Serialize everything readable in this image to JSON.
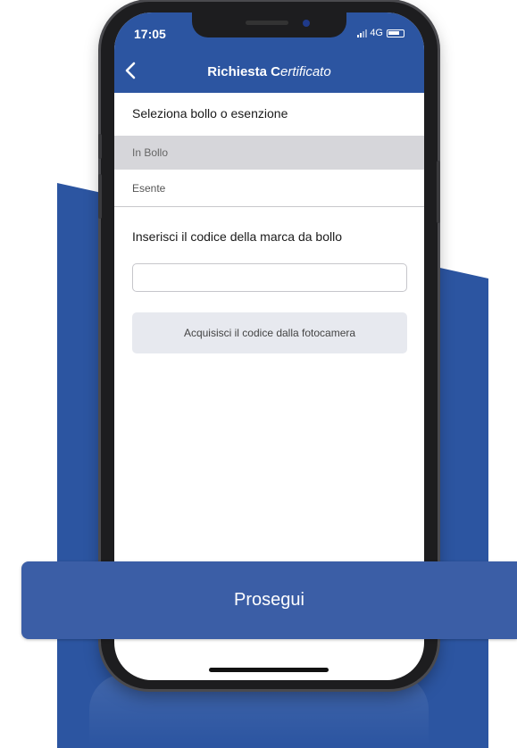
{
  "status_bar": {
    "time": "17:05",
    "network": "4G"
  },
  "header": {
    "title_plain": "Richiesta C",
    "title_italic": "ertificato"
  },
  "stamp_section": {
    "label": "Seleziona bollo o esenzione",
    "options": [
      {
        "label": "In Bollo",
        "selected": true
      },
      {
        "label": "Esente",
        "selected": false
      }
    ]
  },
  "code_section": {
    "label": "Inserisci il codice della marca da bollo",
    "input_value": "",
    "camera_button_label": "Acquisisci il codice dalla fotocamera"
  },
  "footer": {
    "proceed_label": "Prosegui"
  },
  "colors": {
    "brand_blue": "#2c55a1",
    "button_blue": "#3b5ea6",
    "selected_row": "#d6d6da"
  },
  "icons": {
    "back": "chevron-left-icon",
    "signal": "signal-icon",
    "battery": "battery-icon"
  }
}
